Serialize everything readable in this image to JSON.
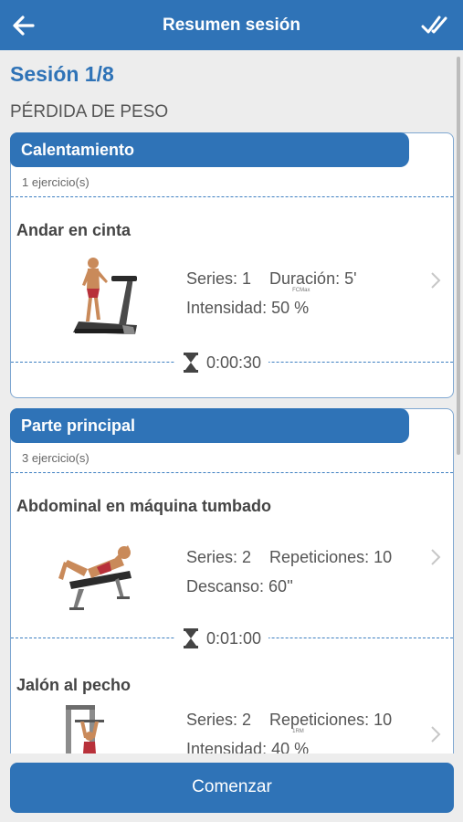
{
  "appbar": {
    "title": "Resumen sesión"
  },
  "session": {
    "label": "Sesión 1/8",
    "objective": "PÉRDIDA DE PESO"
  },
  "blocks": [
    {
      "title": "Calentamiento",
      "count": "1 ejercicio(s)",
      "exercises": [
        {
          "name": "Andar en cinta",
          "line1a": "Series: 1",
          "line1b": "Duración: 5'",
          "line2": "Intensidad: 50",
          "unit": "%",
          "unit_sup": "FCMax",
          "rest": "0:00:30"
        }
      ]
    },
    {
      "title": "Parte principal",
      "count": "3 ejercicio(s)",
      "exercises": [
        {
          "name": "Abdominal en máquina tumbado",
          "line1a": "Series: 2",
          "line1b": "Repeticiones: 10",
          "line2": "Descanso: 60''",
          "rest": "0:01:00"
        },
        {
          "name": "Jalón al pecho",
          "line1a": "Series: 2",
          "line1b": "Repeticiones: 10",
          "line2": "Intensidad: 40",
          "unit": "%",
          "unit_sup": "1RM"
        }
      ]
    }
  ],
  "footer": {
    "start_label": "Comenzar"
  },
  "icons": {
    "back": "arrow-left-icon",
    "confirm": "double-check-icon",
    "rest": "hourglass-icon",
    "chevron": "chevron-right-icon"
  },
  "colors": {
    "primary": "#2f73b7",
    "background": "#ededed"
  }
}
